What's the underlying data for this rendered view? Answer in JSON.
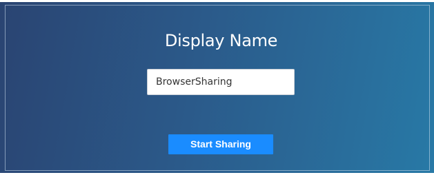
{
  "dialog": {
    "title": "Display Name",
    "display_name_input": {
      "value": "BrowserSharing",
      "placeholder": ""
    },
    "start_button_label": "Start Sharing"
  },
  "colors": {
    "background_start": "#2a4472",
    "background_end": "#2879a6",
    "button": "#1a8cff",
    "text": "#ffffff"
  }
}
